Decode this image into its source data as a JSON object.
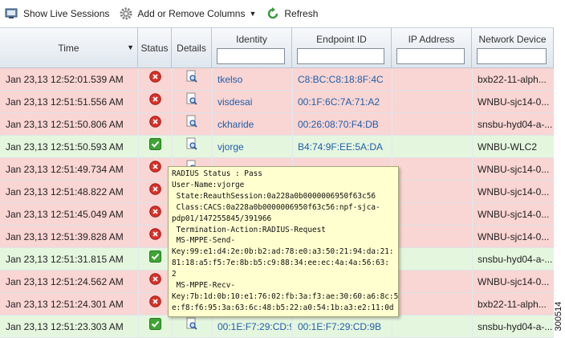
{
  "toolbar": {
    "show_live_sessions": "Show Live Sessions",
    "add_remove_columns": "Add or Remove Columns",
    "refresh": "Refresh"
  },
  "headers": {
    "time": "Time",
    "status": "Status",
    "details": "Details",
    "identity": "Identity",
    "endpoint_id": "Endpoint ID",
    "ip_address": "IP Address",
    "network_device": "Network Device"
  },
  "filters": {
    "identity": "",
    "endpoint_id": "",
    "ip_address": "",
    "network_device": ""
  },
  "rows": [
    {
      "time": "Jan 23,13 12:52:01.539 AM",
      "status": "fail",
      "identity": "tkelso",
      "endpoint": "C8:BC:C8:18:8F:4C",
      "ip": "",
      "device": "bxb22-11-alph..."
    },
    {
      "time": "Jan 23,13 12:51:51.556 AM",
      "status": "fail",
      "identity": "visdesai",
      "endpoint": "00:1F:6C:7A:71:A2",
      "ip": "",
      "device": "WNBU-sjc14-0..."
    },
    {
      "time": "Jan 23,13 12:51:50.806 AM",
      "status": "fail",
      "identity": "ckharide",
      "endpoint": "00:26:08:70:F4:DB",
      "ip": "",
      "device": "snsbu-hyd04-a-..."
    },
    {
      "time": "Jan 23,13 12:51:50.593 AM",
      "status": "pass",
      "identity": "vjorge",
      "endpoint": "B4:74:9F:EE:5A:DA",
      "ip": "",
      "device": "WNBU-WLC2"
    },
    {
      "time": "Jan 23,13 12:51:49.734 AM",
      "status": "fail",
      "identity": "",
      "endpoint": "",
      "ip": "",
      "device": "WNBU-sjc14-0..."
    },
    {
      "time": "Jan 23,13 12:51:48.822 AM",
      "status": "fail",
      "identity": "",
      "endpoint": "",
      "ip": "",
      "device": "WNBU-sjc14-0..."
    },
    {
      "time": "Jan 23,13 12:51:45.049 AM",
      "status": "fail",
      "identity": "",
      "endpoint": "",
      "ip": "",
      "device": "WNBU-sjc14-0..."
    },
    {
      "time": "Jan 23,13 12:51:39.828 AM",
      "status": "fail",
      "identity": "",
      "endpoint": "",
      "ip": "",
      "device": "WNBU-sjc14-0..."
    },
    {
      "time": "Jan 23,13 12:51:31.815 AM",
      "status": "pass",
      "identity": "",
      "endpoint": "",
      "ip": "",
      "device": "snsbu-hyd04-a-..."
    },
    {
      "time": "Jan 23,13 12:51:24.562 AM",
      "status": "fail",
      "identity": "",
      "endpoint": "",
      "ip": "",
      "device": "WNBU-sjc14-0..."
    },
    {
      "time": "Jan 23,13 12:51:24.301 AM",
      "status": "fail",
      "identity": "",
      "endpoint": "",
      "ip": "",
      "device": "bxb22-11-alph..."
    },
    {
      "time": "Jan 23,13 12:51:23.303 AM",
      "status": "pass",
      "identity": "00:1E:F7:29:CD:9",
      "endpoint": "00:1E:F7:29:CD:9B",
      "ip": "",
      "device": "snsbu-hyd04-a-..."
    }
  ],
  "tooltip": {
    "lines": [
      "RADIUS Status : Pass",
      "User-Name:vjorge",
      " State:ReauthSession:0a228a0b0000006950f63c56",
      " Class:CACS:0a228a0b0000006950f63c56:npf-sjca-",
      "pdp01/147255845/391966",
      " Termination-Action:RADIUS-Request",
      " MS-MPPE-Send-",
      "Key:99:e1:d4:2e:0b:b2:ad:78:e0:a3:50:21:94:da:21:",
      "81:18:a5:f5:7e:8b:b5:c9:88:34:ee:ec:4a:4a:56:63:",
      "2",
      " MS-MPPE-Recv-",
      "Key:7b:1d:0b:10:e1:76:02:fb:3a:f3:ae:30:60:a6:8c:5",
      "e:f8:f6:95:3a:63:6c:48:b5:22:a0:54:1b:a3:e2:11:0d"
    ]
  },
  "figure_number": "300514",
  "colors": {
    "fail_row": "#f9d5d3",
    "pass_row": "#e5f6df",
    "link": "#1f5ea8",
    "fail_icon": "#d9312a",
    "pass_icon": "#3fa535",
    "tooltip_bg": "#ffffd0"
  },
  "icons": {
    "show_live_sessions": "monitor-sessions-icon",
    "add_remove_columns": "gear-icon",
    "refresh": "refresh-icon",
    "fail_status": "red-x-circle-icon",
    "pass_status": "green-check-icon",
    "details": "magnifier-document-icon"
  }
}
